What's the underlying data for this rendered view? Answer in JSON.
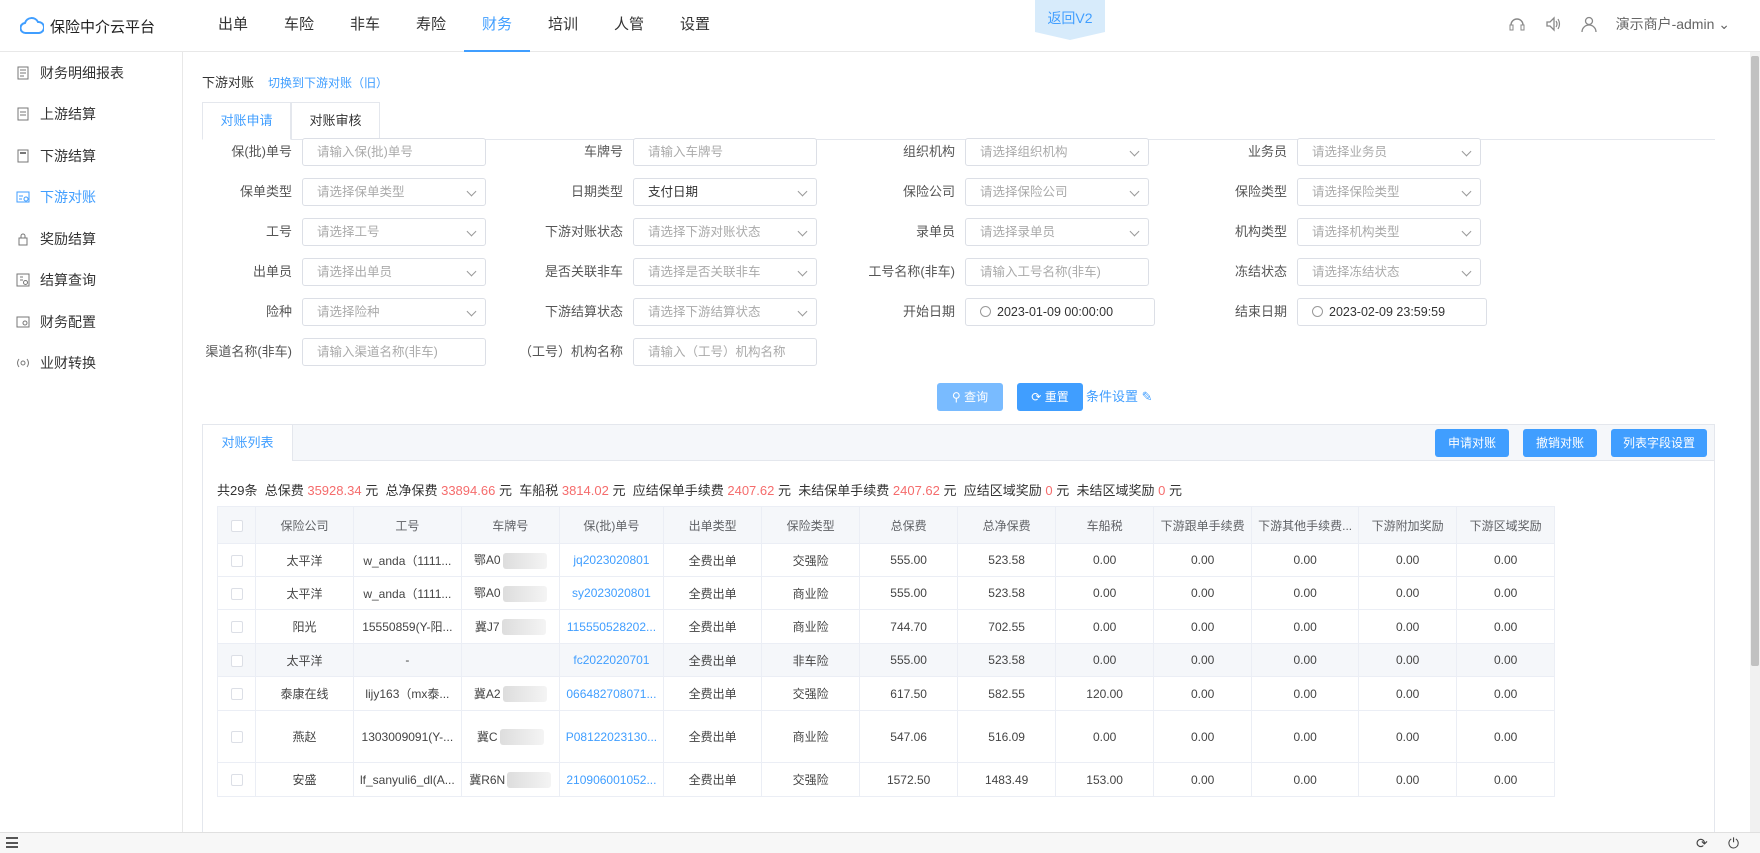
{
  "app": {
    "logo_text": "保险中介云平台",
    "back_v2": "返回V2",
    "user": "演示商户-admin"
  },
  "nav": [
    "出单",
    "车险",
    "非车",
    "寿险",
    "财务",
    "培训",
    "人管",
    "设置"
  ],
  "sidebar": [
    {
      "label": "财务明细报表",
      "icon": "report-icon"
    },
    {
      "label": "上游结算",
      "icon": "document-icon"
    },
    {
      "label": "下游结算",
      "icon": "calculator-icon"
    },
    {
      "label": "下游对账",
      "icon": "reconcile-icon"
    },
    {
      "label": "奖励结算",
      "icon": "lock-icon"
    },
    {
      "label": "结算查询",
      "icon": "query-icon"
    },
    {
      "label": "财务配置",
      "icon": "config-icon"
    },
    {
      "label": "业财转换",
      "icon": "convert-icon"
    }
  ],
  "page": {
    "title": "下游对账",
    "switch_link": "切换到下游对账（旧）"
  },
  "tabs": [
    "对账申请",
    "对账审核"
  ],
  "filters": {
    "r1": [
      {
        "label": "保(批)单号",
        "placeholder": "请输入保(批)单号",
        "type": "input"
      },
      {
        "label": "车牌号",
        "placeholder": "请输入车牌号",
        "type": "input"
      },
      {
        "label": "组织机构",
        "placeholder": "请选择组织机构",
        "type": "select"
      },
      {
        "label": "业务员",
        "placeholder": "请选择业务员",
        "type": "select"
      }
    ],
    "r2": [
      {
        "label": "保单类型",
        "placeholder": "请选择保单类型",
        "type": "select"
      },
      {
        "label": "日期类型",
        "value": "支付日期",
        "type": "select"
      },
      {
        "label": "保险公司",
        "placeholder": "请选择保险公司",
        "type": "select"
      },
      {
        "label": "保险类型",
        "placeholder": "请选择保险类型",
        "type": "select"
      }
    ],
    "r3": [
      {
        "label": "工号",
        "placeholder": "请选择工号",
        "type": "select"
      },
      {
        "label": "下游对账状态",
        "placeholder": "请选择下游对账状态",
        "type": "select"
      },
      {
        "label": "录单员",
        "placeholder": "请选择录单员",
        "type": "select"
      },
      {
        "label": "机构类型",
        "placeholder": "请选择机构类型",
        "type": "select"
      }
    ],
    "r4": [
      {
        "label": "出单员",
        "placeholder": "请选择出单员",
        "type": "select"
      },
      {
        "label": "是否关联非车",
        "placeholder": "请选择是否关联非车",
        "type": "select"
      },
      {
        "label": "工号名称(非车)",
        "placeholder": "请输入工号名称(非车)",
        "type": "input"
      },
      {
        "label": "冻结状态",
        "placeholder": "请选择冻结状态",
        "type": "select"
      }
    ],
    "r5": [
      {
        "label": "险种",
        "placeholder": "请选择险种",
        "type": "select"
      },
      {
        "label": "下游结算状态",
        "placeholder": "请选择下游结算状态",
        "type": "select"
      },
      {
        "label": "开始日期",
        "value": "2023-01-09 00:00:00",
        "type": "date"
      },
      {
        "label": "结束日期",
        "value": "2023-02-09 23:59:59",
        "type": "date"
      }
    ],
    "r6": [
      {
        "label": "渠道名称(非车)",
        "placeholder": "请输入渠道名称(非车)",
        "type": "input"
      },
      {
        "label": "（工号）机构名称",
        "placeholder": "请输入（工号）机构名称",
        "type": "input"
      }
    ]
  },
  "actions": {
    "query": "查询",
    "reset": "重置",
    "conditions": "条件设置"
  },
  "list": {
    "tab": "对账列表",
    "buttons": [
      "申请对账",
      "撤销对账",
      "列表字段设置"
    ],
    "summary": {
      "count": "共29条",
      "items": [
        {
          "label": "总保费",
          "value": "35928.34",
          "unit": "元"
        },
        {
          "label": "总净保费",
          "value": "33894.66",
          "unit": "元"
        },
        {
          "label": "车船税",
          "value": "3814.02",
          "unit": "元"
        },
        {
          "label": "应结保单手续费",
          "value": "2407.62",
          "unit": "元"
        },
        {
          "label": "未结保单手续费",
          "value": "2407.62",
          "unit": "元"
        },
        {
          "label": "应结区域奖励",
          "value": "0",
          "unit": "元"
        },
        {
          "label": "未结区域奖励",
          "value": "0",
          "unit": "元"
        }
      ]
    },
    "columns": [
      "保险公司",
      "工号",
      "车牌号",
      "保(批)单号",
      "出单类型",
      "保险类型",
      "总保费",
      "总净保费",
      "车船税",
      "下游跟单手续费",
      "下游其他手续费...",
      "下游附加奖励",
      "下游区域奖励"
    ],
    "rows": [
      [
        "太平洋",
        "w_anda（1111...",
        "鄂A0",
        "jq2023020801",
        "全费出单",
        "交强险",
        "555.00",
        "523.58",
        "0.00",
        "0.00",
        "0.00",
        "0.00",
        "0.00"
      ],
      [
        "太平洋",
        "w_anda（1111...",
        "鄂A0",
        "sy2023020801",
        "全费出单",
        "商业险",
        "555.00",
        "523.58",
        "0.00",
        "0.00",
        "0.00",
        "0.00",
        "0.00"
      ],
      [
        "阳光",
        "15550859(Y-阳...",
        "冀J7",
        "115550528202...",
        "全费出单",
        "商业险",
        "744.70",
        "702.55",
        "0.00",
        "0.00",
        "0.00",
        "0.00",
        "0.00"
      ],
      [
        "太平洋",
        "-",
        "",
        "fc2022020701",
        "全费出单",
        "非车险",
        "555.00",
        "523.58",
        "0.00",
        "0.00",
        "0.00",
        "0.00",
        "0.00"
      ],
      [
        "泰康在线",
        "lijy163（mx泰...",
        "冀A2",
        "066482708071...",
        "全费出单",
        "交强险",
        "617.50",
        "582.55",
        "120.00",
        "0.00",
        "0.00",
        "0.00",
        "0.00"
      ],
      [
        "燕赵",
        "1303009091(Y-...",
        "冀C",
        "P08122023130...",
        "全费出单",
        "商业险",
        "547.06",
        "516.09",
        "0.00",
        "0.00",
        "0.00",
        "0.00",
        "0.00"
      ],
      [
        "安盛",
        "lf_sanyuli6_dl(A...",
        "冀R6N",
        "210906001052...",
        "全费出单",
        "交强险",
        "1572.50",
        "1483.49",
        "153.00",
        "0.00",
        "0.00",
        "0.00",
        "0.00"
      ]
    ]
  }
}
